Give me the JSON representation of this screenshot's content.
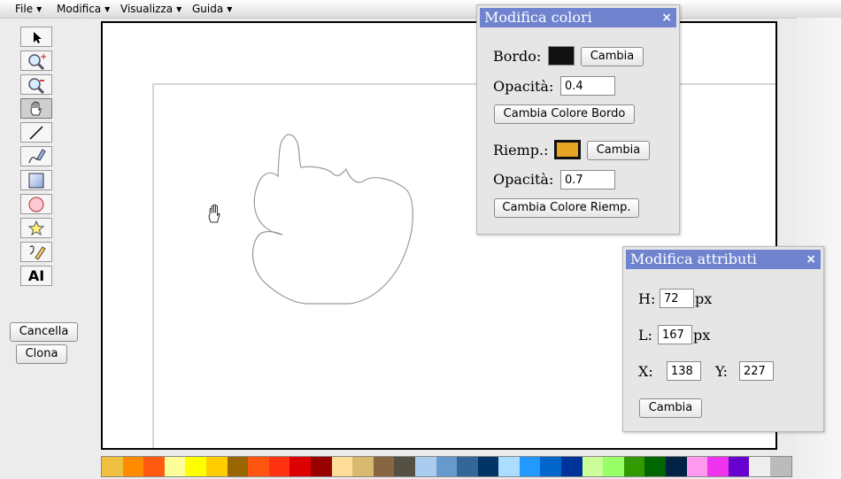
{
  "menu": [
    {
      "label": "File"
    },
    {
      "label": "Modifica"
    },
    {
      "label": "Visualizza"
    },
    {
      "label": "Guida"
    }
  ],
  "toolbar": {
    "tools": [
      {
        "name": "select-tool-icon"
      },
      {
        "name": "zoom-in-tool-icon"
      },
      {
        "name": "zoom-out-tool-icon"
      },
      {
        "name": "pan-hand-tool-icon"
      },
      {
        "name": "line-tool-icon"
      },
      {
        "name": "freehand-pen-tool-icon"
      },
      {
        "name": "rectangle-tool-icon"
      },
      {
        "name": "ellipse-tool-icon"
      },
      {
        "name": "star-shape-tool-icon"
      },
      {
        "name": "path-edit-tool-icon"
      },
      {
        "name": "text-tool-icon"
      }
    ],
    "active_tool": "pan-hand-tool-icon",
    "text_tool_label": "AI"
  },
  "actions": {
    "delete_label": "Cancella",
    "clone_label": "Clona"
  },
  "colors_panel": {
    "title": "Modifica colori",
    "close": "×",
    "stroke_label": "Bordo:",
    "stroke_color": "#111111",
    "stroke_change": "Cambia",
    "stroke_opacity_label": "Opacità:",
    "stroke_opacity": "0.4",
    "stroke_apply": "Cambia Colore Bordo",
    "fill_label": "Riemp.:",
    "fill_color": "#e8a424",
    "fill_change": "Cambia",
    "fill_opacity_label": "Opacità:",
    "fill_opacity": "0.7",
    "fill_apply": "Cambia Colore Riemp."
  },
  "attributes_panel": {
    "title": "Modifica attributi",
    "close": "×",
    "h_label": "H:",
    "h_value": "72",
    "w_label": "L:",
    "w_value": "167",
    "unit": "px",
    "x_label": "X:",
    "x_value": "138",
    "y_label": "Y:",
    "y_value": "227",
    "apply": "Cambia"
  },
  "palette": [
    "#f0c040",
    "#ff8c00",
    "#ff5a10",
    "#ffff99",
    "#ffff00",
    "#ffcc00",
    "#996600",
    "#ff5511",
    "#ff3311",
    "#dd0000",
    "#990000",
    "#ffdd99",
    "#d9b870",
    "#886644",
    "#555044",
    "#aaccee",
    "#6699cc",
    "#336699",
    "#003366",
    "#aaddff",
    "#2299ff",
    "#0066cc",
    "#003399",
    "#ccff99",
    "#99ff66",
    "#339900",
    "#006600",
    "#002244",
    "#ff99ee",
    "#ee33ee",
    "#6600cc",
    "#eeeeee",
    "#bbbbbb"
  ]
}
